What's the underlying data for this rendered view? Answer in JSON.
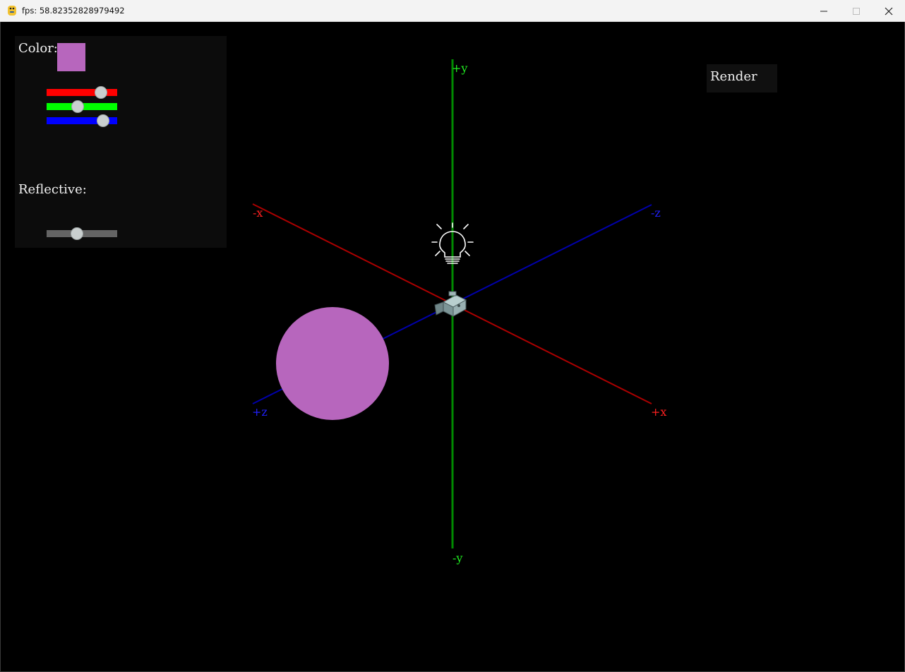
{
  "window": {
    "title": "fps: 58.82352828979492",
    "app_icon": "python-icon",
    "controls": [
      "minimize-icon",
      "maximize-icon",
      "close-icon"
    ]
  },
  "panel": {
    "color_label": "Color:",
    "color_swatch": "#b766bd",
    "sliders": [
      {
        "name": "red",
        "track_color": "#ff0000",
        "value": 0.77
      },
      {
        "name": "green",
        "track_color": "#00ff00",
        "value": 0.44
      },
      {
        "name": "blue",
        "track_color": "#0000ff",
        "value": 0.8
      }
    ],
    "reflective_label": "Reflective:",
    "reflective": {
      "track_color": "#646464",
      "value": 0.43
    }
  },
  "render_button": "Render",
  "scene": {
    "axes": [
      {
        "axis": "x",
        "color": "#aa0000",
        "label_color": "#ff2020",
        "neg_label": "-x",
        "pos_label": "+x"
      },
      {
        "axis": "y",
        "color": "#008a00",
        "label_color": "#22ee22",
        "neg_label": "-y",
        "pos_label": "+y"
      },
      {
        "axis": "z",
        "color": "#0000aa",
        "label_color": "#2020ff",
        "neg_label": "+z",
        "pos_label": "-z"
      }
    ],
    "sphere_color": "#b766bd",
    "light_icon": "lightbulb-icon",
    "camera_icon": "camera-icon"
  }
}
